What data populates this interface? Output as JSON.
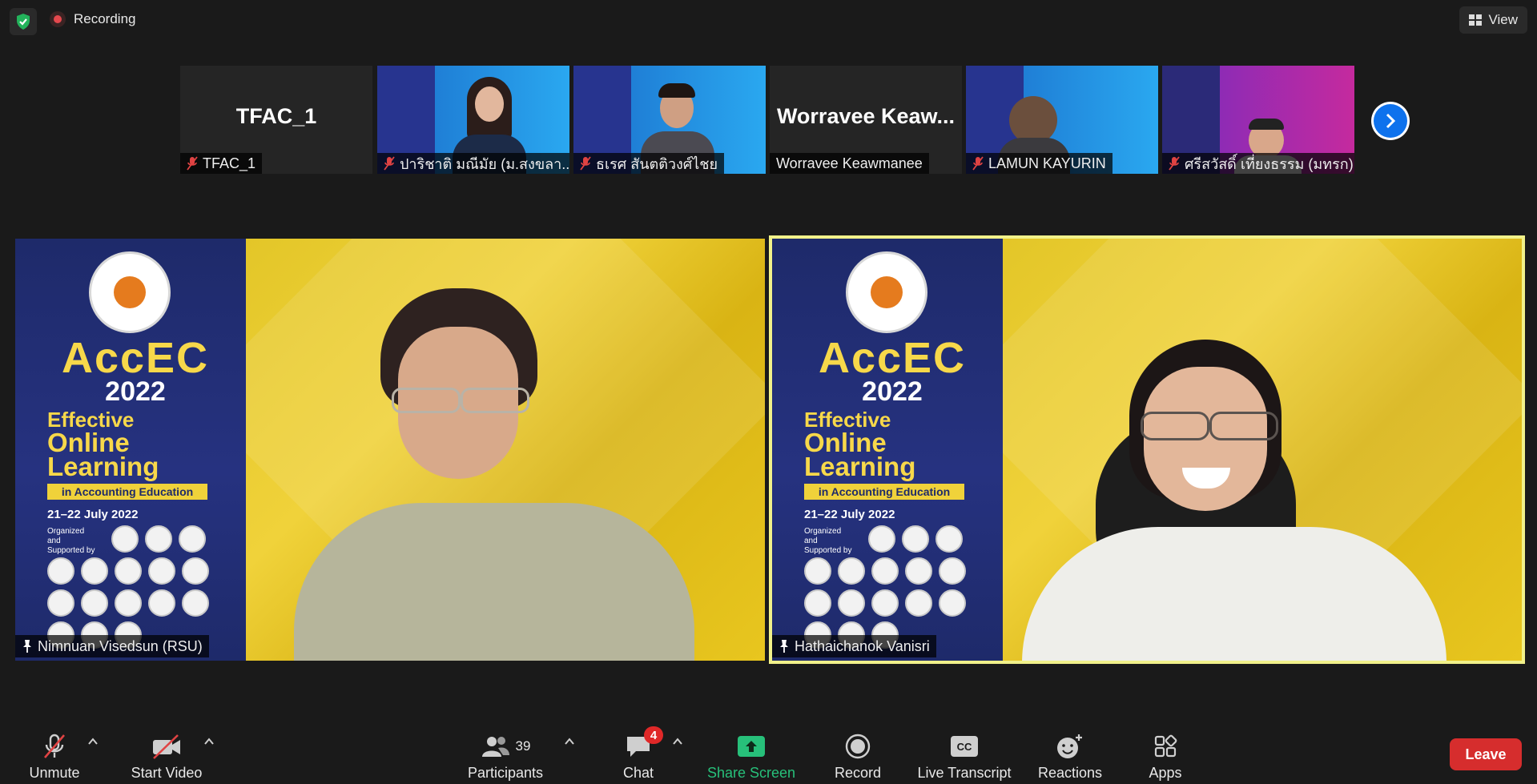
{
  "top_bar": {
    "recording_label": "Recording",
    "view_label": "View",
    "shield_icon": "shield-check-icon"
  },
  "thumbnails": [
    {
      "big_name": "TFAC_1",
      "name": "TFAC_1",
      "video": false,
      "muted": true
    },
    {
      "name": "ปาริชาติ มณีมัย (ม.สงขลา...",
      "video": true,
      "muted": true
    },
    {
      "name": "ธเรศ สันตติวงศ์ไชย",
      "video": true,
      "muted": true
    },
    {
      "big_name": "Worravee  Keaw...",
      "name": "Worravee Keawmanee",
      "video": false,
      "muted": false
    },
    {
      "name": "LAMUN KAYURIN",
      "video": true,
      "muted": true
    },
    {
      "name": "ศรีสวัสดิ์ เที่ยงธรรม (มทรก)",
      "video": true,
      "muted": true
    }
  ],
  "poster": {
    "title": "AccEC",
    "year": "2022",
    "line1": "Effective",
    "line2": "Online",
    "line3": "Learning",
    "banner": "in Accounting Education",
    "date": "21–22 July 2022",
    "organized": "Organized and Supported by"
  },
  "main_tiles": [
    {
      "name": "Nimnuan Visedsun (RSU)",
      "active": false
    },
    {
      "name": "Hathaichanok Vanisri",
      "active": true
    }
  ],
  "toolbar": {
    "unmute_label": "Unmute",
    "start_video_label": "Start Video",
    "participants_label": "Participants",
    "participants_count": "39",
    "chat_label": "Chat",
    "chat_badge": "4",
    "share_screen_label": "Share Screen",
    "record_label": "Record",
    "live_transcript_label": "Live Transcript",
    "reactions_label": "Reactions",
    "apps_label": "Apps",
    "leave_label": "Leave",
    "cc_text": "CC"
  },
  "colors": {
    "share_green": "#27c07a",
    "leave_red": "#d62d2d",
    "active_border": "#f1f18a",
    "accent_blue": "#0e72ed"
  }
}
